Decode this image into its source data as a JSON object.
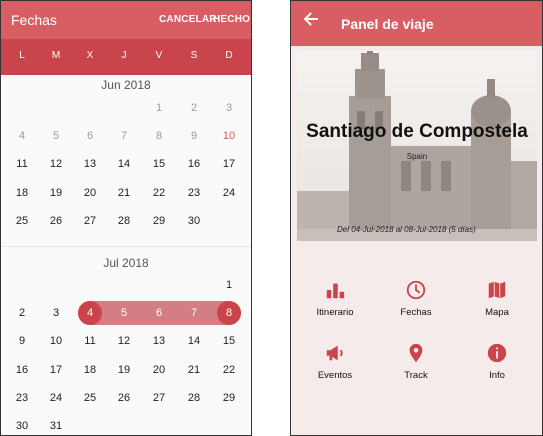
{
  "calendar": {
    "title": "Fechas",
    "cancel_label": "CANCELAR",
    "done_label": "HECHO",
    "weekdays": [
      "L",
      "M",
      "X",
      "J",
      "V",
      "S",
      "D"
    ],
    "months": [
      {
        "label": "Jun 2018",
        "weeks": [
          [
            "",
            "",
            "",
            "",
            "1",
            "2",
            "3"
          ],
          [
            "4",
            "5",
            "6",
            "7",
            "8",
            "9",
            "10"
          ],
          [
            "11",
            "12",
            "13",
            "14",
            "15",
            "16",
            "17"
          ],
          [
            "18",
            "19",
            "20",
            "21",
            "22",
            "23",
            "24"
          ],
          [
            "25",
            "26",
            "27",
            "28",
            "29",
            "30",
            ""
          ]
        ]
      },
      {
        "label": "Jul 2018",
        "weeks": [
          [
            "",
            "",
            "",
            "",
            "",
            "",
            "1"
          ],
          [
            "2",
            "3",
            "4",
            "5",
            "6",
            "7",
            "8"
          ],
          [
            "9",
            "10",
            "11",
            "12",
            "13",
            "14",
            "15"
          ],
          [
            "16",
            "17",
            "18",
            "19",
            "20",
            "21",
            "22"
          ],
          [
            "23",
            "24",
            "25",
            "26",
            "27",
            "28",
            "29"
          ],
          [
            "30",
            "31",
            "",
            "",
            "",
            "",
            ""
          ]
        ]
      }
    ],
    "selection": {
      "start": "4 Jul 2018",
      "end": "8 Jul 2018"
    },
    "colors": {
      "header": "#d85e63",
      "weekbar": "#c9454b",
      "range": "#d27e82",
      "selected": "#c9454b",
      "today": "#d85e63"
    }
  },
  "panel": {
    "title": "Panel de viaje",
    "back_icon": "arrow-back-icon",
    "hero": {
      "city": "Santiago de Compostela",
      "country": "Spain",
      "dates": "Del 04-Jul-2018 al 08-Jul-2018 (5 días)"
    },
    "tiles": [
      {
        "label": "Itinerario",
        "icon": "bar-chart-icon"
      },
      {
        "label": "Fechas",
        "icon": "clock-icon"
      },
      {
        "label": "Mapa",
        "icon": "map-icon"
      },
      {
        "label": "Eventos",
        "icon": "megaphone-icon"
      },
      {
        "label": "Track",
        "icon": "location-pin-icon"
      },
      {
        "label": "Info",
        "icon": "info-icon"
      }
    ],
    "colors": {
      "header": "#d85e63",
      "icon": "#c9454b",
      "background": "#f6ebeb"
    }
  }
}
